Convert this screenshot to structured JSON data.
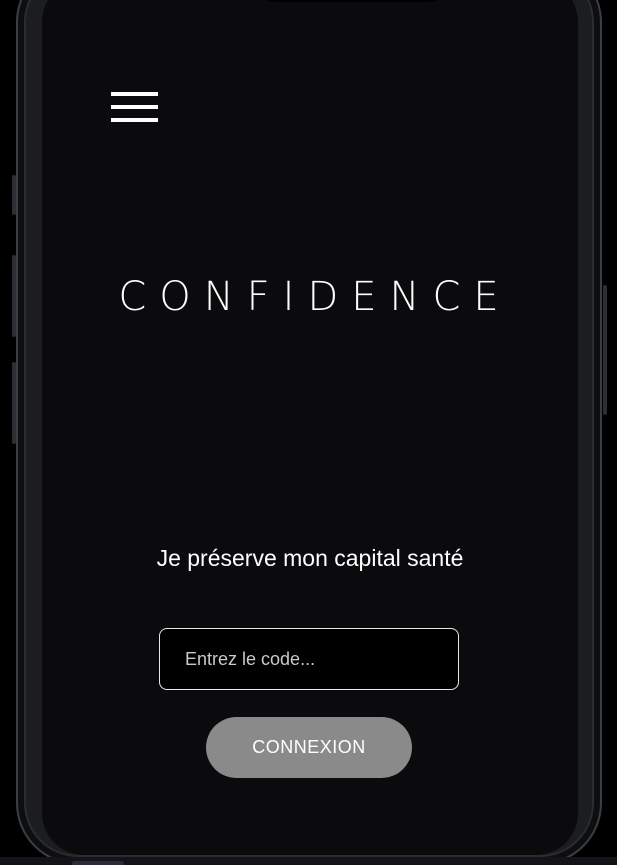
{
  "app": {
    "brand_title": "CONFIDENCE",
    "tagline": "Je préserve mon capital santé"
  },
  "header": {
    "menu_icon": "hamburger-menu-icon"
  },
  "login": {
    "code_input": {
      "placeholder": "Entrez le code...",
      "value": ""
    },
    "connect_label": "CONNEXION"
  },
  "colors": {
    "screen_background": "#0b0a0c",
    "text": "#ffffff",
    "button_background": "#8a8a8a",
    "input_border": "#e8e8e8"
  }
}
